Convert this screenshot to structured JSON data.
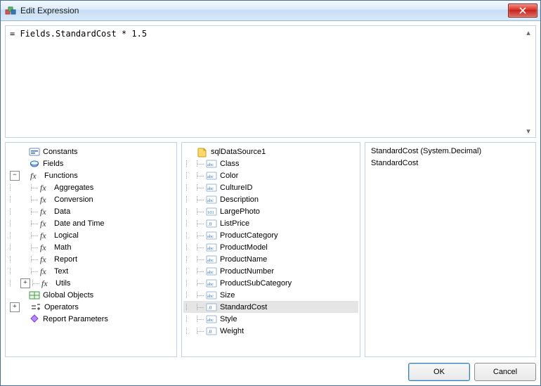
{
  "window": {
    "title": "Edit Expression"
  },
  "expression": {
    "text": "= Fields.StandardCost * 1.5"
  },
  "categoryTree": [
    {
      "expander": " ",
      "depth": 0,
      "icon": "constants-icon",
      "label": "Constants"
    },
    {
      "expander": " ",
      "depth": 0,
      "icon": "fields-icon",
      "label": "Fields"
    },
    {
      "expander": "-",
      "depth": 0,
      "icon": "fx-icon",
      "label": "Functions"
    },
    {
      "expander": "",
      "depth": 1,
      "icon": "fx-icon",
      "label": "Aggregates"
    },
    {
      "expander": "",
      "depth": 1,
      "icon": "fx-icon",
      "label": "Conversion"
    },
    {
      "expander": "",
      "depth": 1,
      "icon": "fx-icon",
      "label": "Data"
    },
    {
      "expander": "",
      "depth": 1,
      "icon": "fx-icon",
      "label": "Date and Time"
    },
    {
      "expander": "",
      "depth": 1,
      "icon": "fx-icon",
      "label": "Logical"
    },
    {
      "expander": "",
      "depth": 1,
      "icon": "fx-icon",
      "label": "Math"
    },
    {
      "expander": "",
      "depth": 1,
      "icon": "fx-icon",
      "label": "Report"
    },
    {
      "expander": "",
      "depth": 1,
      "icon": "fx-icon",
      "label": "Text"
    },
    {
      "expander": "+",
      "depth": 1,
      "icon": "fx-icon",
      "label": "Utils"
    },
    {
      "expander": " ",
      "depth": 0,
      "icon": "globals-icon",
      "label": "Global Objects"
    },
    {
      "expander": "+",
      "depth": 0,
      "icon": "operators-icon",
      "label": "Operators"
    },
    {
      "expander": " ",
      "depth": 0,
      "icon": "param-icon",
      "label": "Report Parameters"
    }
  ],
  "fieldTree": {
    "source": {
      "icon": "datasource-icon",
      "label": "sqlDataSource1"
    },
    "fields": [
      {
        "icon": "abc-icon",
        "label": "Class"
      },
      {
        "icon": "abc-icon",
        "label": "Color"
      },
      {
        "icon": "abc-icon",
        "label": "CultureID"
      },
      {
        "icon": "abc-icon",
        "label": "Description"
      },
      {
        "icon": "bin-icon",
        "label": "LargePhoto"
      },
      {
        "icon": "num-icon",
        "label": "ListPrice"
      },
      {
        "icon": "abc-icon",
        "label": "ProductCategory"
      },
      {
        "icon": "abc-icon",
        "label": "ProductModel"
      },
      {
        "icon": "abc-icon",
        "label": "ProductName"
      },
      {
        "icon": "abc-icon",
        "label": "ProductNumber"
      },
      {
        "icon": "abc-icon",
        "label": "ProductSubCategory"
      },
      {
        "icon": "abc-icon",
        "label": "Size"
      },
      {
        "icon": "num-icon",
        "label": "StandardCost",
        "selected": true
      },
      {
        "icon": "abc-icon",
        "label": "Style"
      },
      {
        "icon": "num-icon",
        "label": "Weight"
      }
    ]
  },
  "info": {
    "signature": "StandardCost (System.Decimal)",
    "description": "StandardCost"
  },
  "buttons": {
    "ok": "OK",
    "cancel": "Cancel"
  }
}
